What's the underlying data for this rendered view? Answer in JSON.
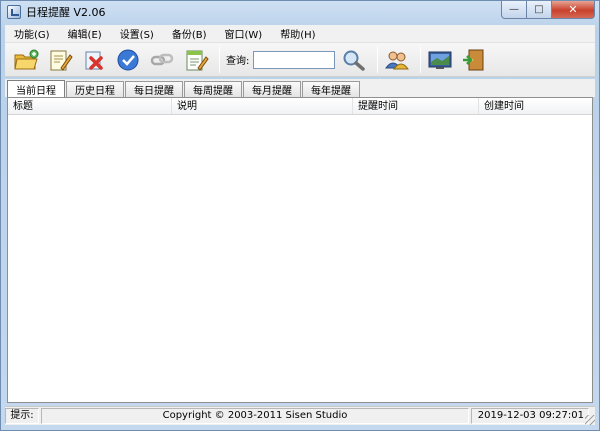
{
  "window": {
    "title": "日程提醒 V2.06",
    "controls": {
      "minimize": "—",
      "maximize": "□",
      "close": "✕"
    }
  },
  "menu": [
    {
      "label": "功能(G)"
    },
    {
      "label": "编辑(E)"
    },
    {
      "label": "设置(S)"
    },
    {
      "label": "备份(B)"
    },
    {
      "label": "窗口(W)"
    },
    {
      "label": "帮助(H)"
    }
  ],
  "toolbar": {
    "search_label": "查询:",
    "search_value": "",
    "icons": [
      "open-folder-icon",
      "edit-note-icon",
      "delete-icon",
      "confirm-check-icon",
      "link-icon",
      "notepad-icon",
      "search-magnifier-icon",
      "users-icon",
      "monitor-icon",
      "exit-door-icon"
    ]
  },
  "tabs": [
    {
      "label": "当前日程",
      "active": true
    },
    {
      "label": "历史日程",
      "active": false
    },
    {
      "label": "每日提醒",
      "active": false
    },
    {
      "label": "每周提醒",
      "active": false
    },
    {
      "label": "每月提醒",
      "active": false
    },
    {
      "label": "每年提醒",
      "active": false
    }
  ],
  "list": {
    "columns": [
      "标题",
      "说明",
      "提醒时间",
      "创建时间"
    ],
    "rows": []
  },
  "status": {
    "hint": "提示:",
    "copyright": "Copyright © 2003-2011 Sisen Studio",
    "datetime": "2019-12-03 09:27:01"
  },
  "colors": {
    "accent": "#2d5a94",
    "close": "#c7412b"
  }
}
